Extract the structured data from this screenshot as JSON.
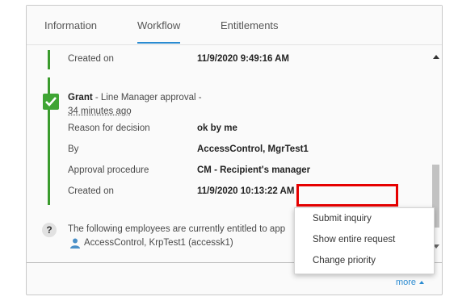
{
  "tabs": [
    {
      "label": "Information",
      "active": false
    },
    {
      "label": "Workflow",
      "active": true
    },
    {
      "label": "Entitlements",
      "active": false
    }
  ],
  "workflow": {
    "first_step": {
      "created_label": "Created on",
      "created_value": "11/9/2020 9:49:16 AM"
    },
    "grant_step": {
      "title_bold": "Grant",
      "title_rest": " - Line Manager approval -",
      "time_ago": "34 minutes ago",
      "reason_label": "Reason for decision",
      "reason_value": "ok by me",
      "by_label": "By",
      "by_value": "AccessControl, MgrTest1",
      "procedure_label": "Approval procedure",
      "procedure_value": "CM - Recipient's manager",
      "created_label": "Created on",
      "created_value": "11/9/2020 10:13:22 AM"
    },
    "pending_step": {
      "text": "The following employees are currently entitled to app",
      "employee": "AccessControl, KrpTest1 (accessk1)"
    }
  },
  "footer": {
    "more_label": "more"
  },
  "context_menu": {
    "items": [
      "Submit inquiry",
      "Show entire request",
      "Change priority"
    ]
  },
  "colors": {
    "accent": "#2a8bd1",
    "approved_green": "#3fa534",
    "highlight_red": "#e60000"
  },
  "icons": {
    "approved": "check-icon",
    "pending": "question-icon",
    "employee": "person-icon",
    "more": "caret-up-icon"
  }
}
